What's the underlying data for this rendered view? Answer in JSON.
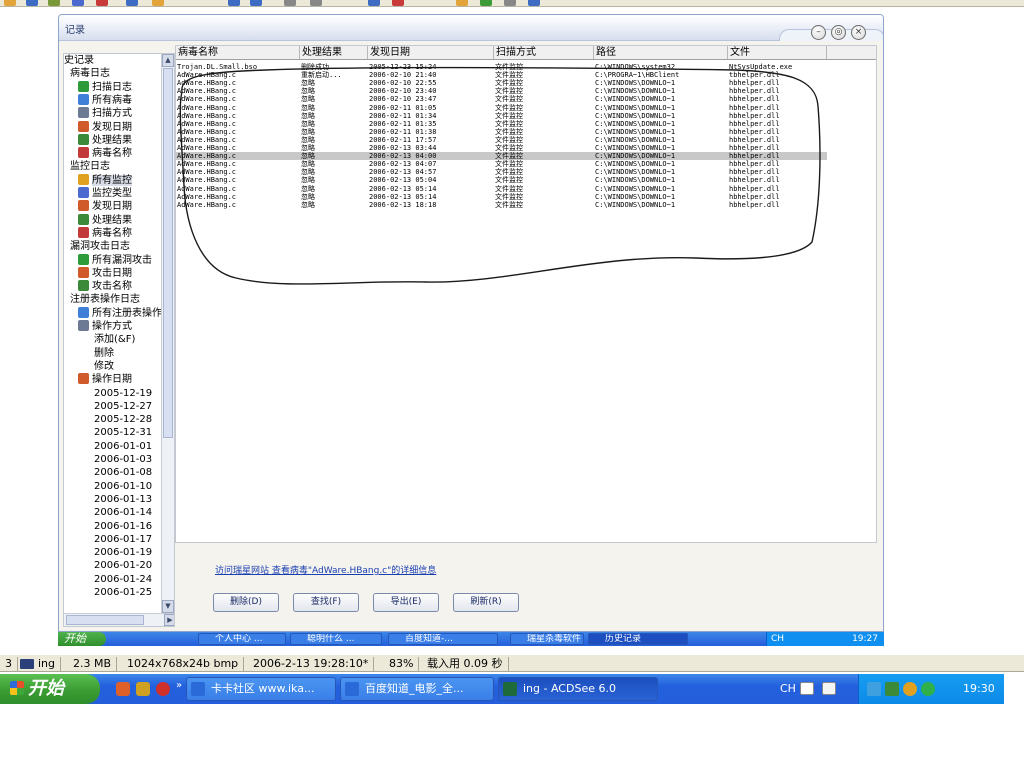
{
  "window": {
    "title": "记录"
  },
  "tree": {
    "items": [
      {
        "label": "史记录",
        "indent": 0,
        "icon": ""
      },
      {
        "label": "病毒日志",
        "indent": 1,
        "icon": ""
      },
      {
        "label": "扫描日志",
        "indent": 2,
        "icon": "#2e9b3a"
      },
      {
        "label": "所有病毒",
        "indent": 2,
        "icon": "#3f7fd8"
      },
      {
        "label": "扫描方式",
        "indent": 2,
        "icon": "#6c7a94"
      },
      {
        "label": "发现日期",
        "indent": 2,
        "icon": "#d05a2a"
      },
      {
        "label": "处理结果",
        "indent": 2,
        "icon": "#3a8a3a"
      },
      {
        "label": "病毒名称",
        "indent": 2,
        "icon": "#c23a3a"
      },
      {
        "label": "监控日志",
        "indent": 1,
        "icon": ""
      },
      {
        "label": "所有监控",
        "indent": 2,
        "icon": "#e0a020",
        "selected": true
      },
      {
        "label": "监控类型",
        "indent": 2,
        "icon": "#4a6ad0"
      },
      {
        "label": "发现日期",
        "indent": 2,
        "icon": "#d05a2a"
      },
      {
        "label": "处理结果",
        "indent": 2,
        "icon": "#3a8a3a"
      },
      {
        "label": "病毒名称",
        "indent": 2,
        "icon": "#c23a3a"
      },
      {
        "label": "漏洞攻击日志",
        "indent": 1,
        "icon": ""
      },
      {
        "label": "所有漏洞攻击",
        "indent": 2,
        "icon": "#2e9b3a"
      },
      {
        "label": "攻击日期",
        "indent": 2,
        "icon": "#d05a2a"
      },
      {
        "label": "攻击名称",
        "indent": 2,
        "icon": "#3a8a3a"
      },
      {
        "label": "注册表操作日志",
        "indent": 1,
        "icon": ""
      },
      {
        "label": "所有注册表操作",
        "indent": 2,
        "icon": "#3f7fd8"
      },
      {
        "label": "操作方式",
        "indent": 2,
        "icon": "#6c7a94"
      },
      {
        "label": "添加(&F)",
        "indent": 3,
        "icon": ""
      },
      {
        "label": "删除",
        "indent": 3,
        "icon": ""
      },
      {
        "label": "修改",
        "indent": 3,
        "icon": ""
      },
      {
        "label": "操作日期",
        "indent": 2,
        "icon": "#d05a2a"
      },
      {
        "label": "2005-12-19",
        "indent": 3,
        "icon": ""
      },
      {
        "label": "2005-12-27",
        "indent": 3,
        "icon": ""
      },
      {
        "label": "2005-12-28",
        "indent": 3,
        "icon": ""
      },
      {
        "label": "2005-12-31",
        "indent": 3,
        "icon": ""
      },
      {
        "label": "2006-01-01",
        "indent": 3,
        "icon": ""
      },
      {
        "label": "2006-01-03",
        "indent": 3,
        "icon": ""
      },
      {
        "label": "2006-01-08",
        "indent": 3,
        "icon": ""
      },
      {
        "label": "2006-01-10",
        "indent": 3,
        "icon": ""
      },
      {
        "label": "2006-01-13",
        "indent": 3,
        "icon": ""
      },
      {
        "label": "2006-01-14",
        "indent": 3,
        "icon": ""
      },
      {
        "label": "2006-01-16",
        "indent": 3,
        "icon": ""
      },
      {
        "label": "2006-01-17",
        "indent": 3,
        "icon": ""
      },
      {
        "label": "2006-01-19",
        "indent": 3,
        "icon": ""
      },
      {
        "label": "2006-01-20",
        "indent": 3,
        "icon": ""
      },
      {
        "label": "2006-01-24",
        "indent": 3,
        "icon": ""
      },
      {
        "label": "2006-01-25",
        "indent": 3,
        "icon": ""
      }
    ]
  },
  "list": {
    "columns": [
      "病毒名称",
      "处理结果",
      "发现日期",
      "扫描方式",
      "路径",
      "文件"
    ],
    "rows": [
      [
        "Trojan.DL.Small.bso",
        "删除成功",
        "2005-12-23 15:24",
        "文件监控",
        "C:\\WINDOWS\\system32",
        "NtSysUpdate.exe"
      ],
      [
        "AdWare.HBang.c",
        "重新启动...",
        "2006-02-10 21:40",
        "文件监控",
        "C:\\PROGRA~1\\HBClient",
        "tbhelper.dll"
      ],
      [
        "AdWare.HBang.c",
        "忽略",
        "2006-02-10 22:55",
        "文件监控",
        "C:\\WINDOWS\\DOWNLO~1",
        "hbhelper.dll"
      ],
      [
        "AdWare.HBang.c",
        "忽略",
        "2006-02-10 23:40",
        "文件监控",
        "C:\\WINDOWS\\DOWNLO~1",
        "hbhelper.dll"
      ],
      [
        "AdWare.HBang.c",
        "忽略",
        "2006-02-10 23:47",
        "文件监控",
        "C:\\WINDOWS\\DOWNLO~1",
        "hbhelper.dll"
      ],
      [
        "AdWare.HBang.c",
        "忽略",
        "2006-02-11 01:05",
        "文件监控",
        "C:\\WINDOWS\\DOWNLO~1",
        "hbhelper.dll"
      ],
      [
        "AdWare.HBang.c",
        "忽略",
        "2006-02-11 01:34",
        "文件监控",
        "C:\\WINDOWS\\DOWNLO~1",
        "hbhelper.dll"
      ],
      [
        "AdWare.HBang.c",
        "忽略",
        "2006-02-11 01:35",
        "文件监控",
        "C:\\WINDOWS\\DOWNLO~1",
        "hbhelper.dll"
      ],
      [
        "AdWare.HBang.c",
        "忽略",
        "2006-02-11 01:38",
        "文件监控",
        "C:\\WINDOWS\\DOWNLO~1",
        "hbhelper.dll"
      ],
      [
        "AdWare.HBang.c",
        "忽略",
        "2006-02-11 17:57",
        "文件监控",
        "C:\\WINDOWS\\DOWNLO~1",
        "hbhelper.dll"
      ],
      [
        "AdWare.HBang.c",
        "忽略",
        "2006-02-13 03:44",
        "文件监控",
        "C:\\WINDOWS\\DOWNLO~1",
        "hbhelper.dll"
      ],
      [
        "AdWare.HBang.c",
        "忽略",
        "2006-02-13 04:00",
        "文件监控",
        "C:\\WINDOWS\\DOWNLO~1",
        "hbhelper.dll"
      ],
      [
        "AdWare.HBang.c",
        "忽略",
        "2006-02-13 04:07",
        "文件监控",
        "C:\\WINDOWS\\DOWNLO~1",
        "hbhelper.dll"
      ],
      [
        "AdWare.HBang.c",
        "忽略",
        "2006-02-13 04:57",
        "文件监控",
        "C:\\WINDOWS\\DOWNLO~1",
        "hbhelper.dll"
      ],
      [
        "AdWare.HBang.c",
        "忽略",
        "2006-02-13 05:04",
        "文件监控",
        "C:\\WINDOWS\\DOWNLO~1",
        "hbhelper.dll"
      ],
      [
        "AdWare.HBang.c",
        "忽略",
        "2006-02-13 05:14",
        "文件监控",
        "C:\\WINDOWS\\DOWNLO~1",
        "hbhelper.dll"
      ],
      [
        "AdWare.HBang.c",
        "忽略",
        "2006-02-13 05:14",
        "文件监控",
        "C:\\WINDOWS\\DOWNLO~1",
        "hbhelper.dll"
      ],
      [
        "AdWare.HBang.c",
        "忽略",
        "2006-02-13 18:18",
        "文件监控",
        "C:\\WINDOWS\\DOWNLO~1",
        "hbhelper.dll"
      ]
    ],
    "selected_row": 11
  },
  "details_link": "访问瑞星网站 查看病毒\"AdWare.HBang.c\"的详细信息",
  "buttons": {
    "delete": "删除(D)",
    "find": "查找(F)",
    "export": "导出(E)",
    "refresh": "刷新(R)"
  },
  "inner_taskbar": {
    "start": "开始",
    "items": [
      "个人中心 ...",
      "聪明什么 ...",
      "百度知道-...",
      "瑞星杀毒软件",
      "历史记录"
    ],
    "active_index": 4,
    "lang": "CH",
    "clock": "19:27"
  },
  "status_bar": {
    "page": "3",
    "filename": "ing",
    "filesize": "2.3 MB",
    "format": "1024x768x24b bmp",
    "timestamp": "2006-2-13 19:28:10*",
    "zoom": "83%",
    "load_time": "载入用 0.09 秒"
  },
  "taskbar": {
    "start": "开始",
    "items": [
      "卡卡社区 www.ika...",
      "百度知道_电影_全...",
      "ing - ACDSee 6.0"
    ],
    "active_index": 2,
    "lang": "CH",
    "clock": "19:30"
  },
  "colors": {
    "selection": "#c8c8c8",
    "link": "#1a3fb0",
    "taskbar_blue": "#245edb",
    "start_green": "#3a9c33",
    "tray_blue": "#0d8ae8"
  }
}
